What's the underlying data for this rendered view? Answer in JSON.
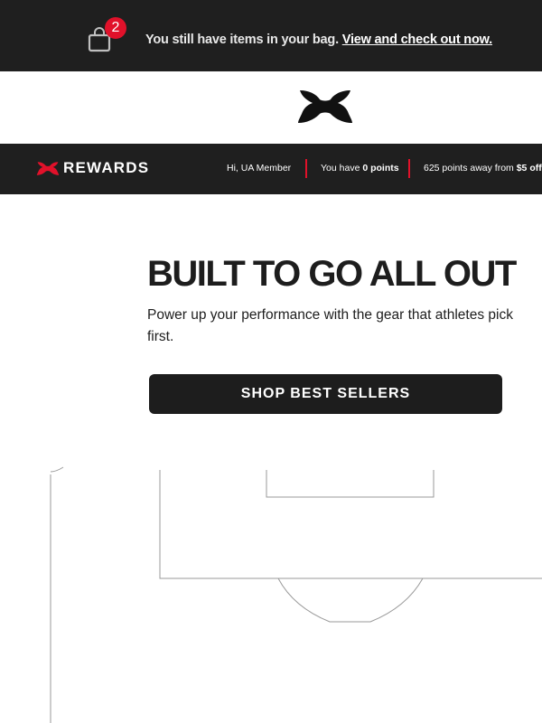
{
  "bag_bar": {
    "badge_count": "2",
    "message": "You still have items in your bag.",
    "link_text": "View and check out now."
  },
  "rewards": {
    "title": "REWARDS",
    "greeting": "Hi, UA Member",
    "points_prefix": "You have ",
    "points_value": "0 points",
    "away_prefix": "625 points away from ",
    "away_value": "$5 off"
  },
  "hero": {
    "title": "BUILT TO GO ALL OUT",
    "subtitle": "Power up your performance with the gear that athletes pick first.",
    "cta_label": "SHOP BEST SELLERS"
  },
  "colors": {
    "dark": "#1f1f1f",
    "accent_red": "#e1112a",
    "white": "#ffffff"
  }
}
